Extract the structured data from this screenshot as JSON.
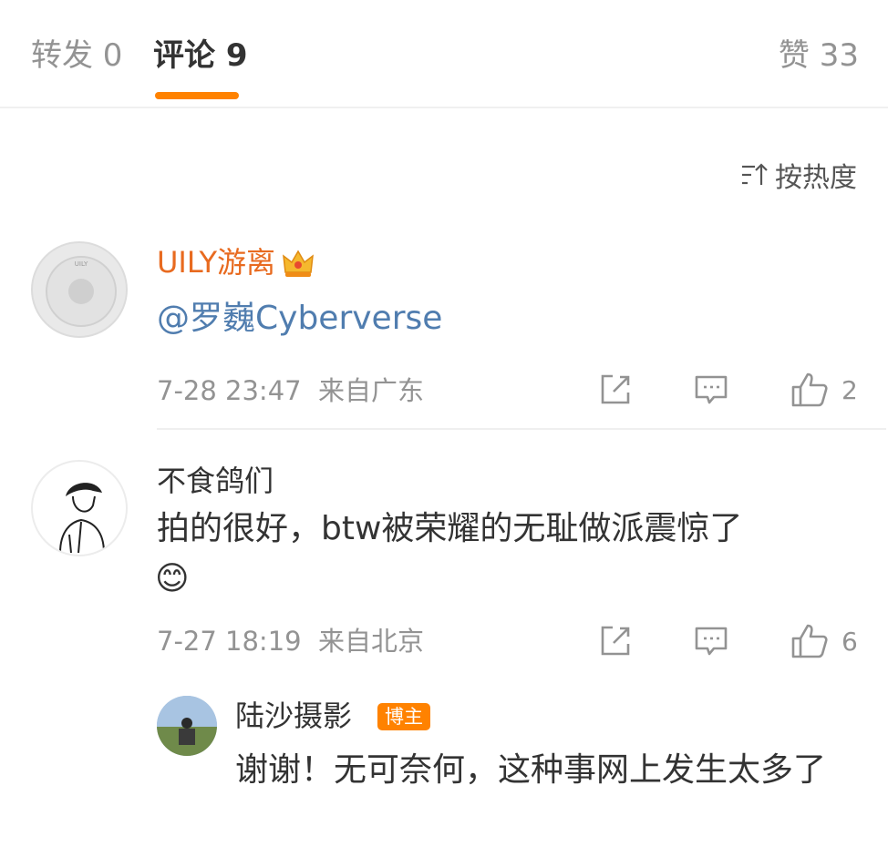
{
  "tabs": {
    "repost": "转发 0",
    "comment": "评论 9",
    "like": "赞 33"
  },
  "sort": {
    "label": "按热度"
  },
  "comments": [
    {
      "user": "UILY游离",
      "text": "@罗巍Cyberverse",
      "time": "7-28 23:47",
      "location": "来自广东",
      "likes": "2",
      "avatar_label": "UILY"
    },
    {
      "user": "不食鸽们",
      "text": "拍的很好，btw被荣耀的无耻做派震惊了",
      "emoji": "😊",
      "time": "7-27 18:19",
      "location": "来自北京",
      "likes": "6"
    }
  ],
  "reply": {
    "user": "陆沙摄影",
    "badge": "博主",
    "text": "谢谢！无可奈何，这种事网上发生太多了"
  },
  "colors": {
    "accent": "#ff8200",
    "name_orange": "#e86a1f",
    "mention_blue": "#507daf",
    "muted": "#939393"
  }
}
